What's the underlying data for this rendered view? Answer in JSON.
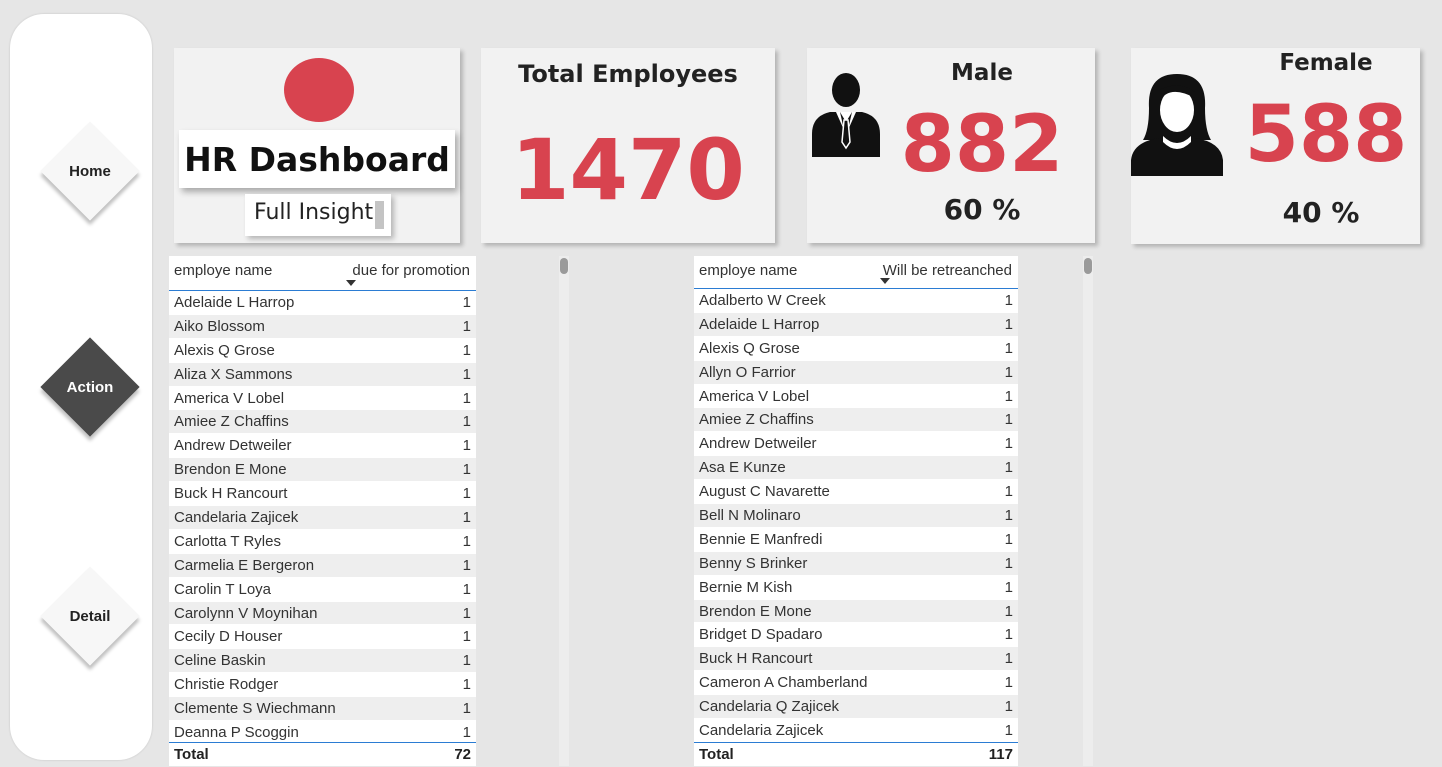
{
  "nav": {
    "home": "Home",
    "action": "Action",
    "detail": "Detail"
  },
  "brand": {
    "title": "HR Dashboard",
    "subtitle": "Full Insight",
    "accent_color": "#d8434f"
  },
  "kpis": {
    "total": {
      "label": "Total Employees",
      "value": "1470"
    },
    "male": {
      "label": "Male",
      "value": "882",
      "percent": "60 %",
      "icon": "man-icon"
    },
    "female": {
      "label": "Female",
      "value": "588",
      "percent": "40 %",
      "icon": "woman-icon"
    }
  },
  "promotion_table": {
    "col_name": "employe name",
    "col_value": "due for promotion",
    "rows": [
      {
        "name": "Adelaide L Harrop",
        "value": "1"
      },
      {
        "name": "Aiko Blossom",
        "value": "1"
      },
      {
        "name": "Alexis Q Grose",
        "value": "1"
      },
      {
        "name": "Aliza X Sammons",
        "value": "1"
      },
      {
        "name": "America V Lobel",
        "value": "1"
      },
      {
        "name": "Amiee Z Chaffins",
        "value": "1"
      },
      {
        "name": "Andrew Detweiler",
        "value": "1"
      },
      {
        "name": "Brendon E Mone",
        "value": "1"
      },
      {
        "name": "Buck H Rancourt",
        "value": "1"
      },
      {
        "name": "Candelaria Zajicek",
        "value": "1"
      },
      {
        "name": "Carlotta T Ryles",
        "value": "1"
      },
      {
        "name": "Carmelia E Bergeron",
        "value": "1"
      },
      {
        "name": "Carolin T Loya",
        "value": "1"
      },
      {
        "name": "Carolynn V Moynihan",
        "value": "1"
      },
      {
        "name": "Cecily D Houser",
        "value": "1"
      },
      {
        "name": "Celine Baskin",
        "value": "1"
      },
      {
        "name": "Christie Rodger",
        "value": "1"
      },
      {
        "name": "Clemente S Wiechmann",
        "value": "1"
      },
      {
        "name": "Deanna P Scoggin",
        "value": "1"
      }
    ],
    "total_label": "Total",
    "total_value": "72"
  },
  "retrench_table": {
    "col_name": "employe name",
    "col_value": "Will be retreanched",
    "rows": [
      {
        "name": "Adalberto W Creek",
        "value": "1"
      },
      {
        "name": "Adelaide L Harrop",
        "value": "1"
      },
      {
        "name": "Alexis Q Grose",
        "value": "1"
      },
      {
        "name": "Allyn O Farrior",
        "value": "1"
      },
      {
        "name": "America V Lobel",
        "value": "1"
      },
      {
        "name": "Amiee Z Chaffins",
        "value": "1"
      },
      {
        "name": "Andrew Detweiler",
        "value": "1"
      },
      {
        "name": "Asa E Kunze",
        "value": "1"
      },
      {
        "name": "August C Navarette",
        "value": "1"
      },
      {
        "name": "Bell N Molinaro",
        "value": "1"
      },
      {
        "name": "Bennie E Manfredi",
        "value": "1"
      },
      {
        "name": "Benny S Brinker",
        "value": "1"
      },
      {
        "name": "Bernie M Kish",
        "value": "1"
      },
      {
        "name": "Brendon E Mone",
        "value": "1"
      },
      {
        "name": "Bridget D Spadaro",
        "value": "1"
      },
      {
        "name": "Buck H Rancourt",
        "value": "1"
      },
      {
        "name": "Cameron A Chamberland",
        "value": "1"
      },
      {
        "name": "Candelaria Q Zajicek",
        "value": "1"
      },
      {
        "name": "Candelaria Zajicek",
        "value": "1"
      }
    ],
    "total_label": "Total",
    "total_value": "117"
  }
}
